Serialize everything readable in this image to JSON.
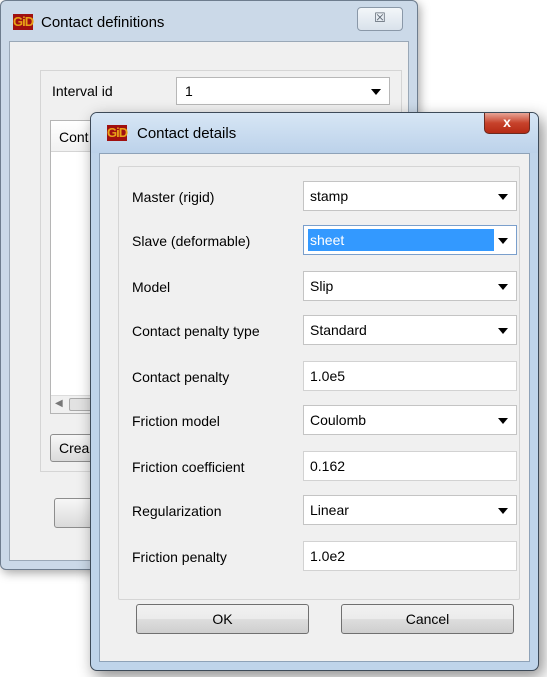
{
  "back_window": {
    "title": "Contact definitions",
    "close_glyph": "☒",
    "interval_label": "Interval id",
    "interval_value": "1",
    "list_header": "Cont",
    "create_button": "Crea"
  },
  "dialog": {
    "title": "Contact details",
    "close_glyph": "x",
    "logo_text": "GiD",
    "fields": {
      "master": {
        "label": "Master (rigid)",
        "value": "stamp"
      },
      "slave": {
        "label": "Slave (deformable)",
        "value": "sheet"
      },
      "model": {
        "label": "Model",
        "value": "Slip"
      },
      "penalty_type": {
        "label": "Contact penalty type",
        "value": "Standard"
      },
      "contact_penalty": {
        "label": "Contact penalty",
        "value": "1.0e5"
      },
      "friction_model": {
        "label": "Friction model",
        "value": "Coulomb"
      },
      "friction_coefficient": {
        "label": "Friction coefficient",
        "value": "0.162"
      },
      "regularization": {
        "label": "Regularization",
        "value": "Linear"
      },
      "friction_penalty": {
        "label": "Friction penalty",
        "value": "1.0e2"
      }
    },
    "ok_label": "OK",
    "cancel_label": "Cancel"
  },
  "colors": {
    "selection": "#3399ff",
    "logo_bg": "#a01010",
    "logo_fg": "#e8a317",
    "close_red": "#c7422b"
  }
}
